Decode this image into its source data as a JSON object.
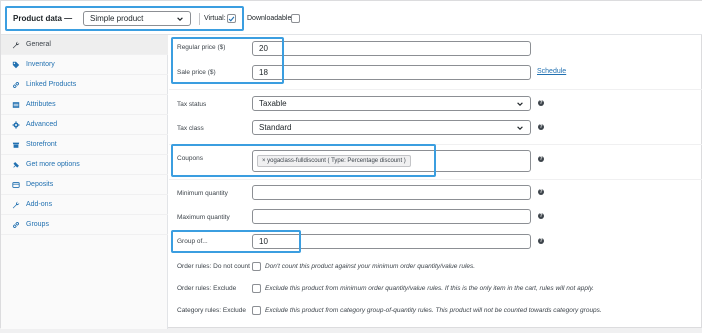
{
  "header": {
    "product_data_label": "Product data —",
    "product_type": "Simple product",
    "virtual_label": "Virtual:",
    "virtual_checked": true,
    "downloadable_label": "Downloadable:",
    "downloadable_checked": false
  },
  "sidebar": {
    "items": [
      {
        "label": "General",
        "icon": "wrench-icon",
        "active": true
      },
      {
        "label": "Inventory",
        "icon": "tag-icon",
        "active": false
      },
      {
        "label": "Linked Products",
        "icon": "link-icon",
        "active": false
      },
      {
        "label": "Attributes",
        "icon": "table-icon",
        "active": false
      },
      {
        "label": "Advanced",
        "icon": "gear-icon",
        "active": false
      },
      {
        "label": "Storefront",
        "icon": "storefront-icon",
        "active": false
      },
      {
        "label": "Get more options",
        "icon": "plugin-icon",
        "active": false
      },
      {
        "label": "Deposits",
        "icon": "card-icon",
        "active": false
      },
      {
        "label": "Add-ons",
        "icon": "wrench-icon",
        "active": false
      },
      {
        "label": "Groups",
        "icon": "link-icon",
        "active": false
      }
    ]
  },
  "general": {
    "regular_price_label": "Regular price ($)",
    "regular_price_value": "20",
    "sale_price_label": "Sale price ($)",
    "sale_price_value": "18",
    "schedule_link": "Schedule",
    "tax_status_label": "Tax status",
    "tax_status_value": "Taxable",
    "tax_class_label": "Tax class",
    "tax_class_value": "Standard",
    "coupons_label": "Coupons",
    "coupon_chip": "× yogaclass-fulldiscount ( Type: Percentage discount )",
    "min_qty_label": "Minimum quantity",
    "min_qty_value": "",
    "max_qty_label": "Maximum quantity",
    "max_qty_value": "",
    "group_of_label": "Group of...",
    "group_of_value": "10",
    "order_rules_label": "Order rules: Do not count",
    "order_rules_desc": "Don't count this product against your minimum order quantity/value rules.",
    "order_rules_exclude_label": "Order rules: Exclude",
    "order_rules_exclude_desc": "Exclude this product from minimum order quantity/value rules. If this is the only item in the cart, rules will not apply.",
    "category_rules_label": "Category rules: Exclude",
    "category_rules_desc": "Exclude this product from category group-of-quantity rules. This product will not be counted towards category groups."
  },
  "colors": {
    "accent": "#2271b1",
    "highlight": "#3b9ee0"
  }
}
